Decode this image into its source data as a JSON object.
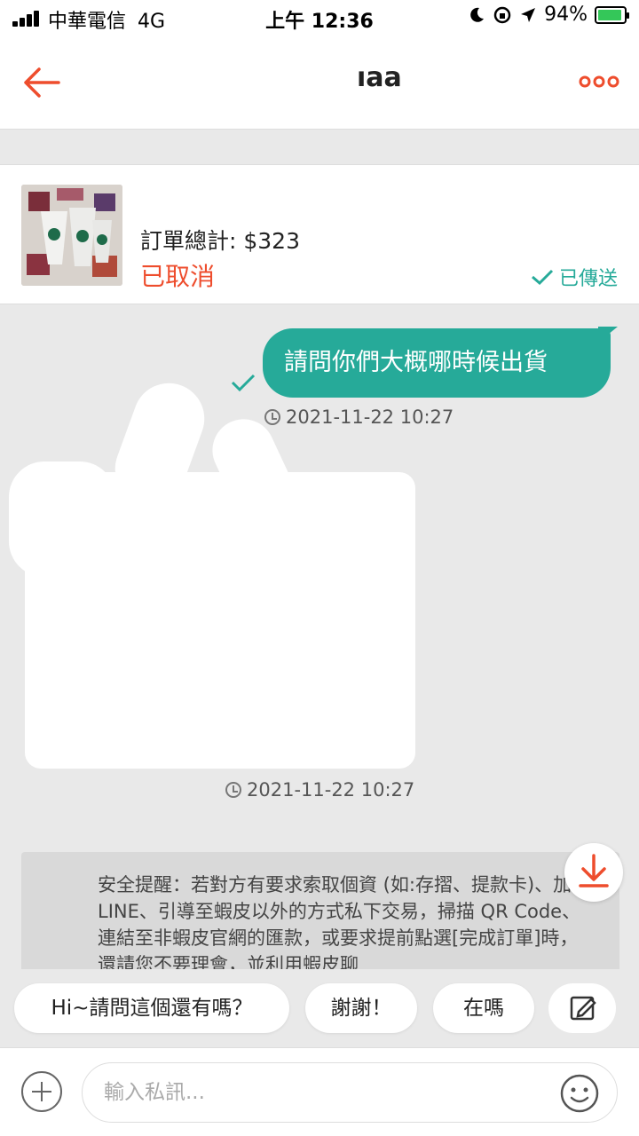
{
  "status_bar": {
    "carrier": "中華電信",
    "network": "4G",
    "time": "上午 12:36",
    "battery": "94%",
    "battery_level": 0.94
  },
  "header": {
    "title": "ıaa"
  },
  "order": {
    "total": "訂單總計: $323",
    "status": "已取消",
    "sent_label": "已傳送"
  },
  "messages": [
    {
      "text": "請問你們大概哪時候出貨",
      "timestamp": "2021-11-22 10:27"
    },
    {
      "timestamp": "2021-11-22 10:27"
    }
  ],
  "safety_notice": "安全提醒：若對方有要求索取個資 (如:存摺、提款卡)、加 LINE、引導至蝦皮以外的方式私下交易，掃描 QR Code、連結至非蝦皮官網的匯款，或要求提前點選[完成訂單]時，還請您不要理會，並利用蝦皮聊",
  "quick_replies": [
    "Hi~請問這個還有嗎？",
    "謝謝！",
    "在嗎"
  ],
  "input": {
    "placeholder": "輸入私訊..."
  },
  "colors": {
    "accent": "#ee4d2d",
    "bubble": "#26aa99"
  }
}
